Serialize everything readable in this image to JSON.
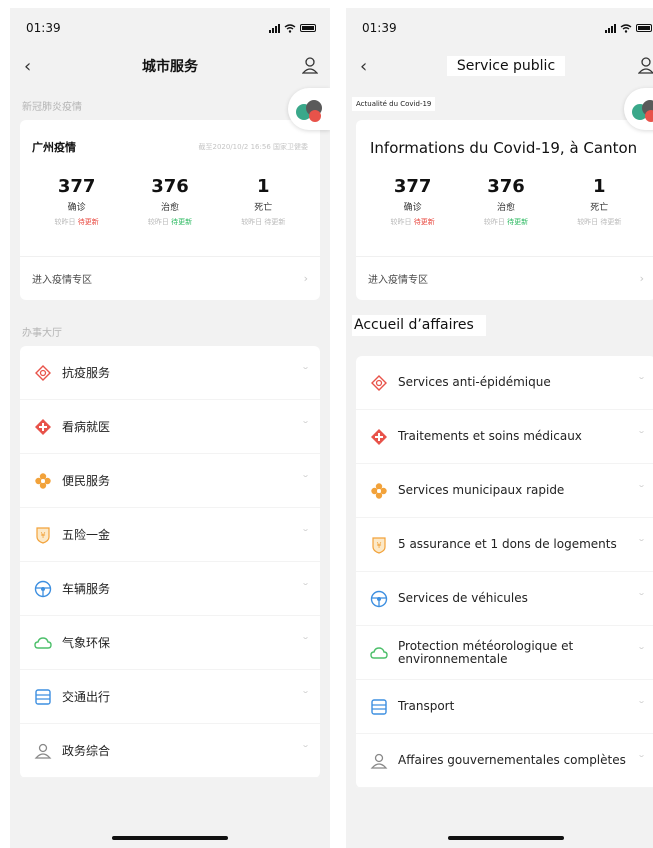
{
  "left": {
    "status": {
      "time": "01:39"
    },
    "nav": {
      "title": "城市服务"
    },
    "covid_section_label": "新冠肺炎疫情",
    "covid": {
      "title": "广州疫情",
      "date": "截至2020/10/2 16:56 国家卫健委",
      "stats": [
        {
          "value": "377",
          "label": "确诊",
          "cmp_prefix": "较昨日",
          "cmp_status": "待更新"
        },
        {
          "value": "376",
          "label": "治愈",
          "cmp_prefix": "较昨日",
          "cmp_status": "待更新"
        },
        {
          "value": "1",
          "label": "死亡",
          "cmp_prefix": "较昨日",
          "cmp_status": "待更新"
        }
      ],
      "link": "进入疫情专区"
    },
    "hall_label": "办事大厅",
    "services": [
      {
        "label": "抗疫服务",
        "icon": "antiepidemic-icon"
      },
      {
        "label": "看病就医",
        "icon": "medical-icon"
      },
      {
        "label": "便民服务",
        "icon": "convenience-icon"
      },
      {
        "label": "五险一金",
        "icon": "insurance-icon"
      },
      {
        "label": "车辆服务",
        "icon": "vehicle-icon"
      },
      {
        "label": "气象环保",
        "icon": "weather-icon"
      },
      {
        "label": "交通出行",
        "icon": "transport-icon"
      },
      {
        "label": "政务综合",
        "icon": "government-icon"
      }
    ]
  },
  "right": {
    "status": {
      "time": "01:39"
    },
    "nav": {
      "title": "Service public"
    },
    "covid_section_label": "Actualité du Covid-19",
    "covid": {
      "title": "Informations du Covid-19, à Canton",
      "stats": [
        {
          "value": "377",
          "label": "确诊",
          "cmp_prefix": "较昨日",
          "cmp_status": "待更新"
        },
        {
          "value": "376",
          "label": "治愈",
          "cmp_prefix": "较昨日",
          "cmp_status": "待更新"
        },
        {
          "value": "1",
          "label": "死亡",
          "cmp_prefix": "较昨日",
          "cmp_status": "待更新"
        }
      ],
      "link": "进入疫情专区"
    },
    "hall_label": "Accueil d’affaires",
    "services": [
      {
        "label": "Services anti-épidémique",
        "icon": "antiepidemic-icon"
      },
      {
        "label": "Traitements et soins médicaux",
        "icon": "medical-icon"
      },
      {
        "label": "Services municipaux rapide",
        "icon": "convenience-icon"
      },
      {
        "label": "5 assurance et 1 dons de logements",
        "icon": "insurance-icon"
      },
      {
        "label": "Services de véhicules",
        "icon": "vehicle-icon"
      },
      {
        "label": "Protection météorologique et environnementale",
        "icon": "weather-icon"
      },
      {
        "label": "Transport",
        "icon": "transport-icon"
      },
      {
        "label": "Affaires gouvernementales complètes",
        "icon": "government-icon"
      }
    ]
  },
  "colors": {
    "update_red": "#e8453c",
    "update_green": "#28b85e",
    "icon_red": "#e8534a",
    "icon_orange": "#f2a23a",
    "icon_blue": "#3d8fe0",
    "icon_green": "#4cbf6a"
  }
}
